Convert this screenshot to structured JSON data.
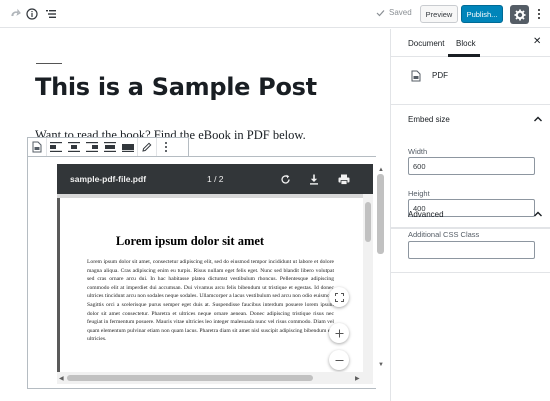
{
  "topbar": {
    "icons": [
      "redo-icon",
      "info-icon",
      "outline-icon"
    ],
    "saved_label": "Saved",
    "preview_label": "Preview",
    "publish_label": "Publish...",
    "settings_icon": "gear-icon",
    "more_icon": "more-vertical-icon"
  },
  "editor": {
    "post_title": "This is a Sample Post",
    "paragraph": "Want to read the book? Find the eBook in PDF below.",
    "pdf": {
      "file_name": "sample-pdf-file.pdf",
      "page_indicator": "1 / 2",
      "page_heading": "Lorem ipsum dolor sit amet",
      "page_body": "Lorem ipsum dolor sit amet, consectetur adipiscing elit, sed do eiusmod tempor incididunt ut labore et dolore magna aliqua. Cras adipiscing enim eu turpis. Risus nullam eget felis eget. Nunc sed blandit libero volutpat sed cras ornare arcu dui. In hac habitasse platea dictumst vestibulum rhoncus. Pellentesque adipiscing commodo elit at imperdiet dui accumsan. Dui vivamus arcu felis bibendum ut tristique et egestas. Id donec ultrices tincidunt arcu non sodales neque sodales. Ullamcorper a lacus vestibulum sed arcu non odio euismod. Sagittis orci a scelerisque purus semper eget duis at. Suspendisse faucibus interdum posuere lorem ipsum dolor sit amet consectetur. Pharetra et ultrices neque ornare aenean. Donec adipiscing tristique risus nec feugiat in fermentum posuere. Mauris vitae ultricies leo integer malesuada nunc vel risus commodo. Diam vel quam elementum pulvinar etiam non quam lacus. Pharetra diam sit amet nisl suscipit adipiscing bibendum est ultricies."
    }
  },
  "sidebar": {
    "tabs": [
      "Document",
      "Block"
    ],
    "active_tab": "Block",
    "block_name": "PDF",
    "embed_panel_title": "Embed size",
    "width_label": "Width",
    "width_value": "600",
    "height_label": "Height",
    "height_value": "400",
    "advanced_title": "Advanced",
    "css_class_label": "Additional CSS Class",
    "css_class_value": ""
  },
  "colors": {
    "publish": "#0085ba",
    "pdf_toolbar": "#323639",
    "settings_bg": "#555d66"
  }
}
